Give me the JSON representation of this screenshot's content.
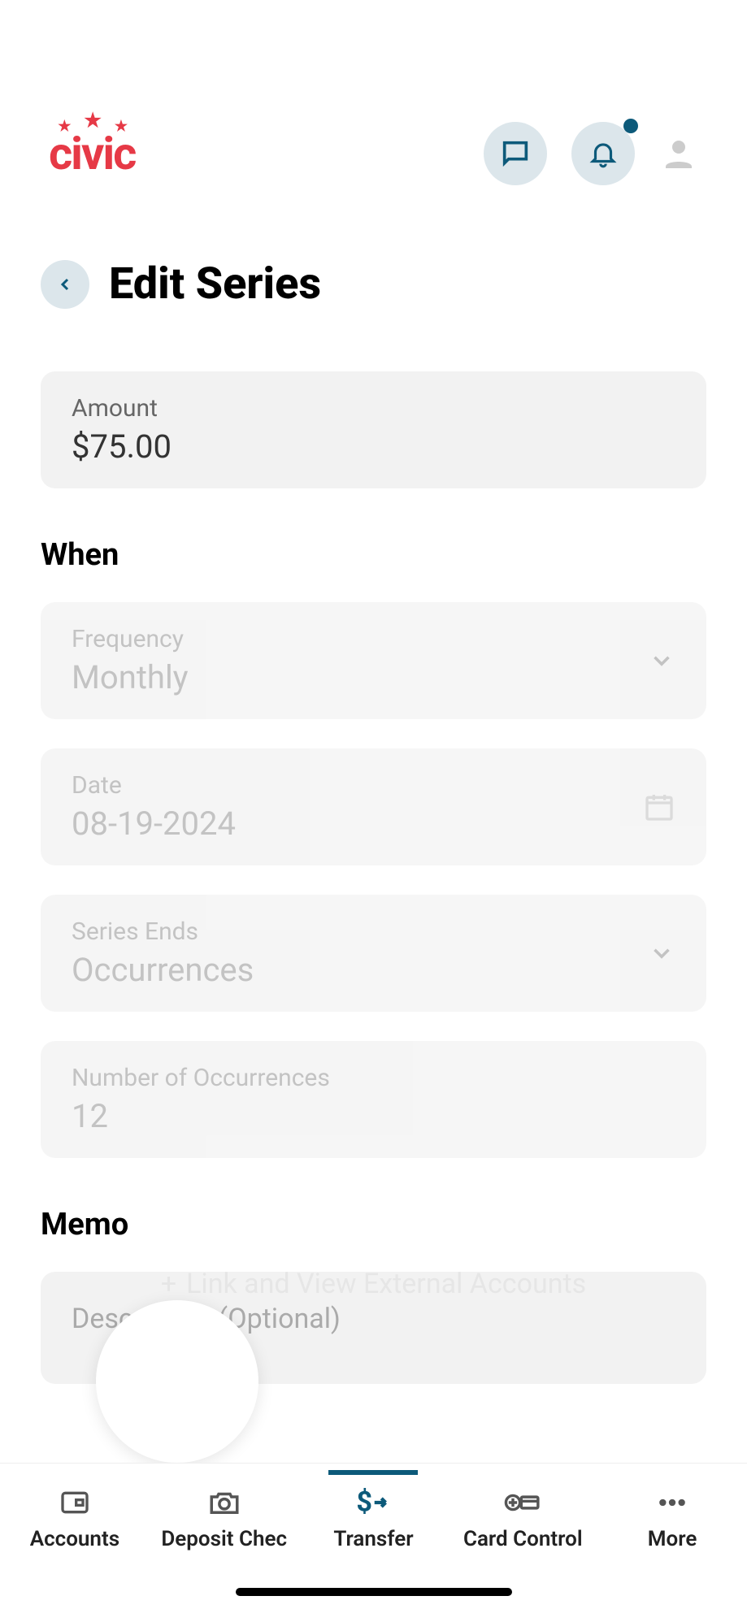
{
  "brand": "civic",
  "pageTitle": "Edit Series",
  "amount": {
    "label": "Amount",
    "value": "$75.00"
  },
  "sections": {
    "when": "When",
    "memo": "Memo"
  },
  "frequency": {
    "label": "Frequency",
    "value": "Monthly"
  },
  "date": {
    "label": "Date",
    "value": "08-19-2024"
  },
  "seriesEnds": {
    "label": "Series Ends",
    "value": "Occurrences"
  },
  "occurrences": {
    "label": "Number of Occurrences",
    "value": "12"
  },
  "memo": {
    "placeholder": "Description (Optional)"
  },
  "ghostLink": "Link and View External Accounts",
  "tabs": {
    "accounts": "Accounts",
    "deposit": "Deposit Chec",
    "transfer": "Transfer",
    "card": "Card Control",
    "more": "More"
  }
}
